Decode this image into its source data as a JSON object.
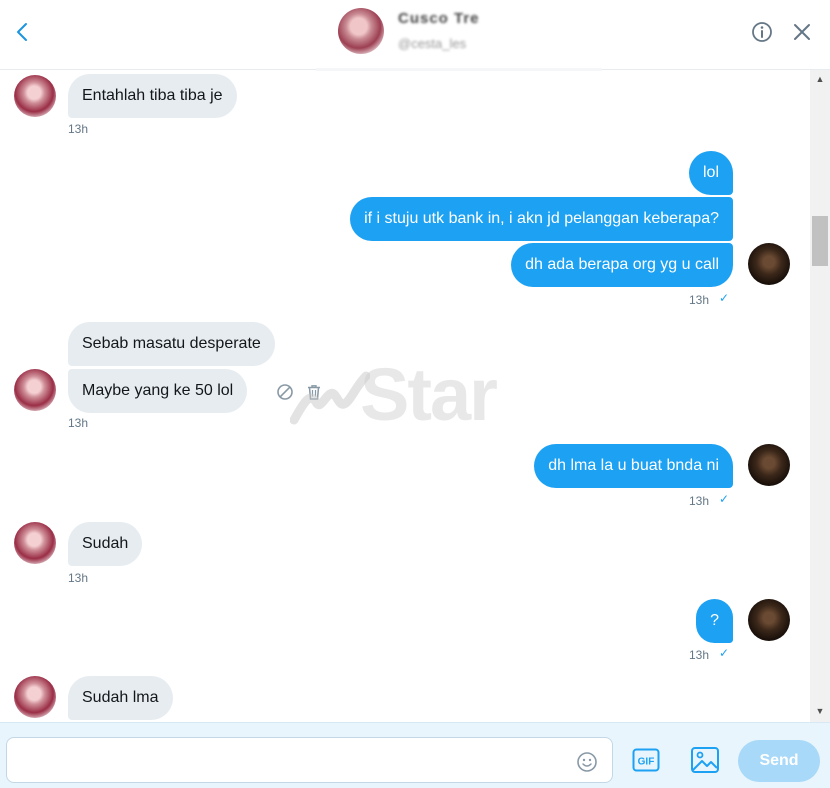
{
  "header": {
    "contact_name": "Cusco Tre",
    "contact_handle": "@cesta_les"
  },
  "messages": [
    {
      "sender": "them",
      "text": "Entahlah tiba tiba je",
      "time": "13h"
    },
    {
      "sender": "me",
      "text": "lol"
    },
    {
      "sender": "me",
      "text": "if i stuju utk bank in, i akn jd pelanggan keberapa?"
    },
    {
      "sender": "me",
      "text": "dh ada berapa org yg u call",
      "time": "13h"
    },
    {
      "sender": "them",
      "text": "Sebab masatu desperate"
    },
    {
      "sender": "them",
      "text": "Maybe yang ke 50 lol",
      "time": "13h"
    },
    {
      "sender": "me",
      "text": "dh lma la u buat bnda ni",
      "time": "13h"
    },
    {
      "sender": "them",
      "text": "Sudah",
      "time": "13h"
    },
    {
      "sender": "me",
      "text": "?",
      "time": "13h"
    },
    {
      "sender": "them",
      "text": "Sudah lma"
    }
  ],
  "read_receipt_icon": "✓",
  "watermark": {
    "text": "Star"
  },
  "composer": {
    "input_value": "",
    "send_label": "Send",
    "gif_label": "GIF"
  },
  "colors": {
    "accent": "#1da1f2",
    "incoming_bubble": "#e6ecf0",
    "send_disabled": "#a8d9f8",
    "composer_bg": "#e8f5fd"
  },
  "icons": [
    "back-icon",
    "info-icon",
    "close-icon",
    "block-icon",
    "trash-icon",
    "emoji-icon",
    "gif-icon",
    "image-icon"
  ]
}
